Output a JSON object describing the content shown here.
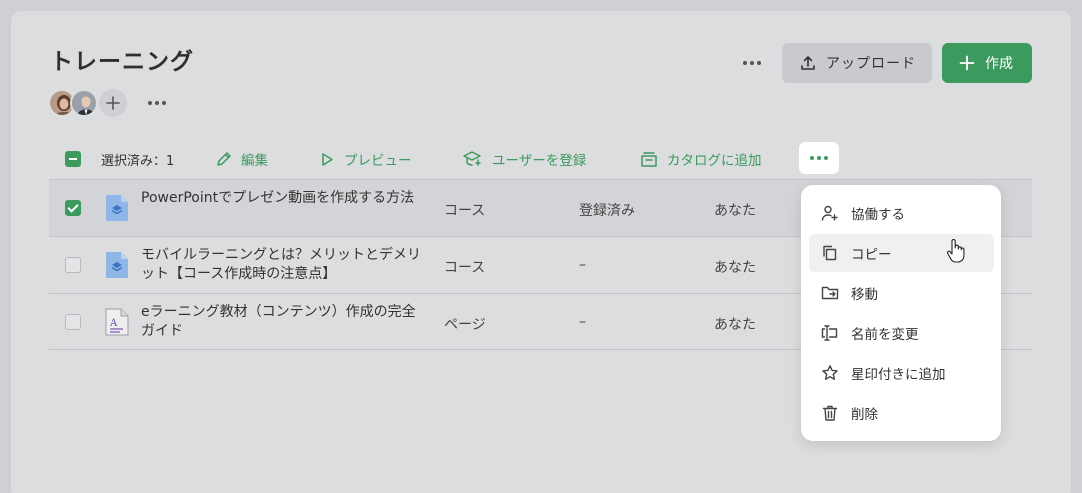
{
  "page": {
    "title": "トレーニング"
  },
  "header": {
    "upload_label": "アップロード",
    "create_label": "作成"
  },
  "toolbar": {
    "selected_label": "選択済み：1",
    "edit_label": "編集",
    "preview_label": "プレビュー",
    "enroll_label": "ユーザーを登録",
    "catalog_label": "カタログに追加"
  },
  "rows": [
    {
      "name": "PowerPointでプレゼン動画を作成する方法",
      "type": "コース",
      "status": "登録済み",
      "owner": "あなた",
      "selected": true,
      "icon": "course-icon"
    },
    {
      "name": "モバイルラーニングとは？メリットとデメリット【コース作成時の注意点】",
      "type": "コース",
      "status": "–",
      "owner": "あなた",
      "selected": false,
      "icon": "course-icon"
    },
    {
      "name": "eラーニング教材（コンテンツ）作成の完全ガイド",
      "type": "ページ",
      "status": "–",
      "owner": "あなた",
      "selected": false,
      "icon": "page-icon"
    }
  ],
  "context_menu": {
    "items": [
      {
        "label": "協働する",
        "icon": "collaborate-icon"
      },
      {
        "label": "コピー",
        "icon": "copy-icon"
      },
      {
        "label": "移動",
        "icon": "move-folder-icon"
      },
      {
        "label": "名前を変更",
        "icon": "rename-icon"
      },
      {
        "label": "星印付きに追加",
        "icon": "star-icon"
      },
      {
        "label": "削除",
        "icon": "trash-icon"
      }
    ]
  },
  "colors": {
    "accent": "#3c9a5f",
    "background": "#dcdddf",
    "menu_bg": "#ffffff"
  }
}
